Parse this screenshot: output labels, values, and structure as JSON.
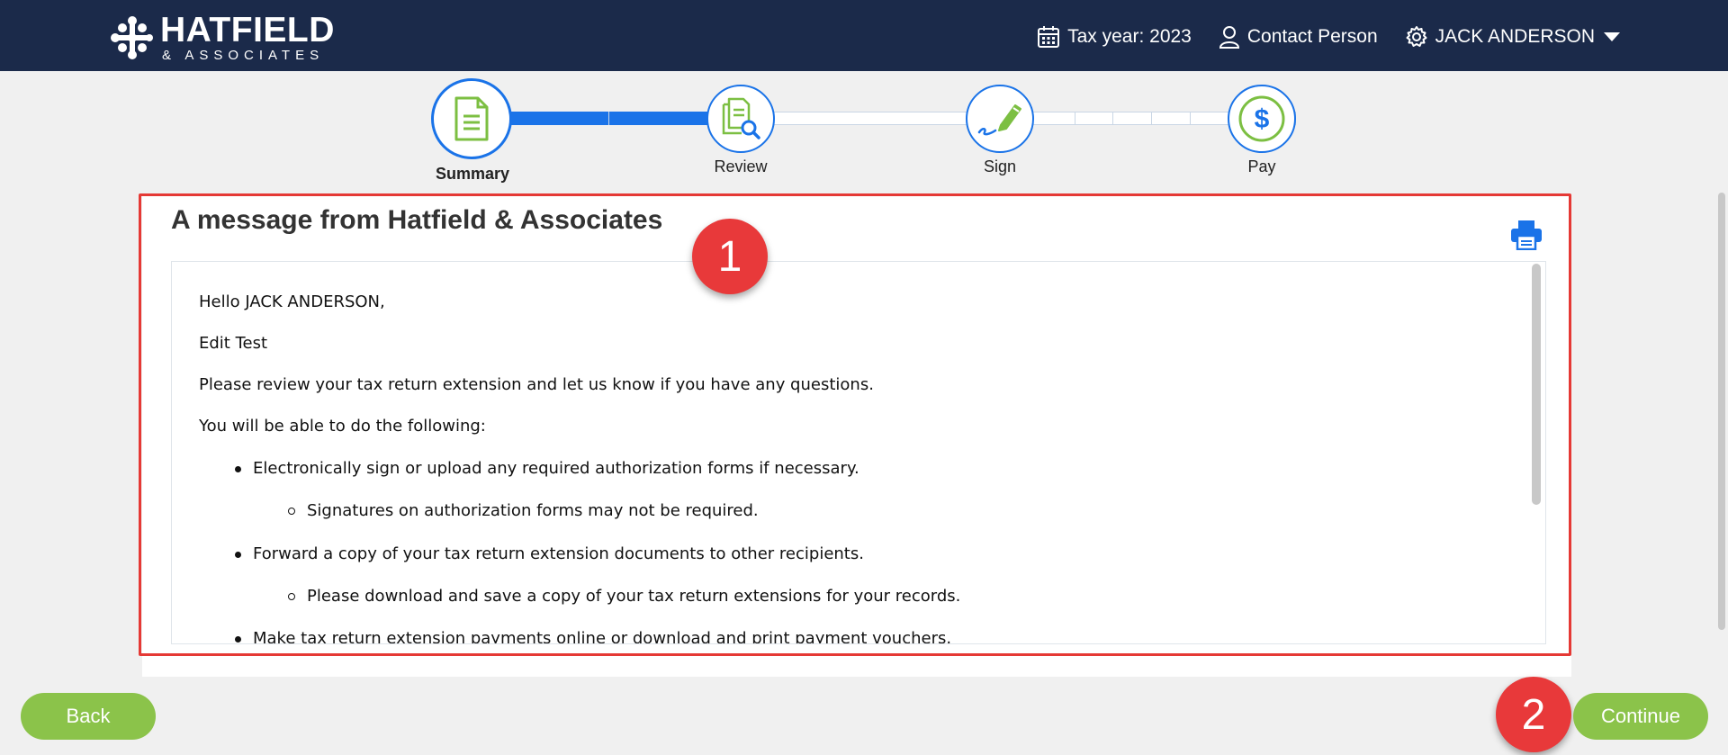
{
  "brand": {
    "name": "HATFIELD",
    "sub": "& ASSOCIATES"
  },
  "header": {
    "tax_year": "Tax year: 2023",
    "contact": "Contact Person",
    "user": "JACK ANDERSON"
  },
  "steps": [
    {
      "label": "Summary",
      "icon": "document-icon",
      "active": true
    },
    {
      "label": "Review",
      "icon": "review-document-icon",
      "active": false
    },
    {
      "label": "Sign",
      "icon": "pen-sign-icon",
      "active": false
    },
    {
      "label": "Pay",
      "icon": "dollar-icon",
      "active": false
    }
  ],
  "progress_fraction": 0.2,
  "message": {
    "title": "A message from Hatfield & Associates",
    "greeting": "Hello JACK ANDERSON,",
    "line1": "Edit Test",
    "line2": "Please review your tax return extension and let us know if you have any questions.",
    "line3": "You will be able to do the following:",
    "bullets": [
      "Electronically sign or upload any required authorization forms if necessary.",
      "Signatures on authorization forms may not be required.",
      "Forward a copy of your tax return extension documents to other recipients.",
      "Please download and save a copy of your tax return extensions for your records.",
      "Make tax return extension payments online or download and print payment vouchers."
    ]
  },
  "badges": [
    "1",
    "2"
  ],
  "buttons": {
    "back": "Back",
    "continue": "Continue"
  },
  "colors": {
    "header_bg": "#1b2a4a",
    "accent": "#1a73e8",
    "button": "#8bc34a",
    "badge": "#e8393a",
    "icon_green": "#7cbf42"
  }
}
